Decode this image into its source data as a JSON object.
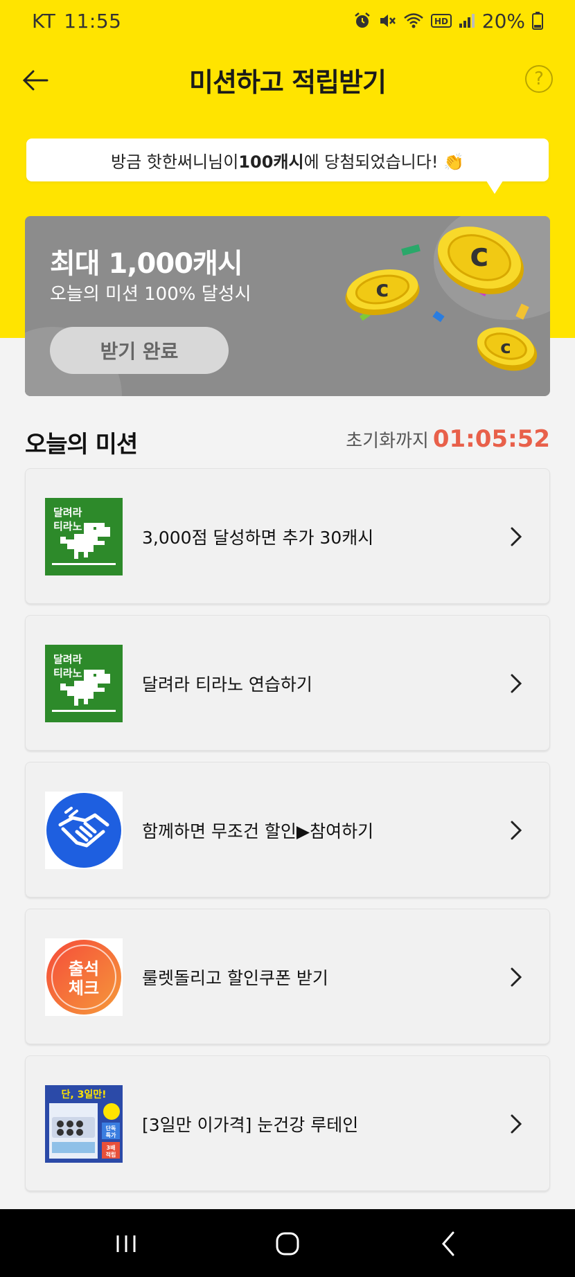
{
  "status_bar": {
    "carrier": "KT",
    "time": "11:55",
    "battery": "20%"
  },
  "header": {
    "title": "미션하고 적립받기",
    "help_label": "?"
  },
  "toast": {
    "prefix": "방금 핫한써니님이 ",
    "highlight": "100캐시",
    "suffix": "에 당첨되었습니다! 👏"
  },
  "banner": {
    "title": "최대 1,000캐시",
    "subtitle": "오늘의 미션 100% 달성시",
    "button_label": "받기 완료",
    "coin_letter": "c",
    "colors": {
      "background": "#8c8c8c",
      "coin": "#f5d21a"
    }
  },
  "missions_section": {
    "title": "오늘의 미션",
    "timer_label": "초기화까지",
    "timer_value": "01:05:52"
  },
  "missions": [
    {
      "label": "3,000점 달성하면 추가 30캐시",
      "thumb": "dino",
      "thumb_text": [
        "달려라",
        "티라노"
      ]
    },
    {
      "label": "달려라 티라노 연습하기",
      "thumb": "dino",
      "thumb_text": [
        "달려라",
        "티라노"
      ]
    },
    {
      "label": "함께하면 무조건 할인▶참여하기",
      "thumb": "handshake"
    },
    {
      "label": "룰렛돌리고 할인쿠폰 받기",
      "thumb": "attendance",
      "thumb_text": [
        "출석",
        "체크"
      ]
    },
    {
      "label": "[3일만 이가격] 눈건강 루테인",
      "thumb": "product",
      "thumb_text": [
        "단, 3일만!",
        "단독",
        "특가",
        "3배",
        "적립"
      ]
    }
  ],
  "colors": {
    "accent_yellow": "#ffe400",
    "timer_red": "#e8604a",
    "dino_green": "#2d8a2a",
    "handshake_blue": "#1e5fe0"
  }
}
